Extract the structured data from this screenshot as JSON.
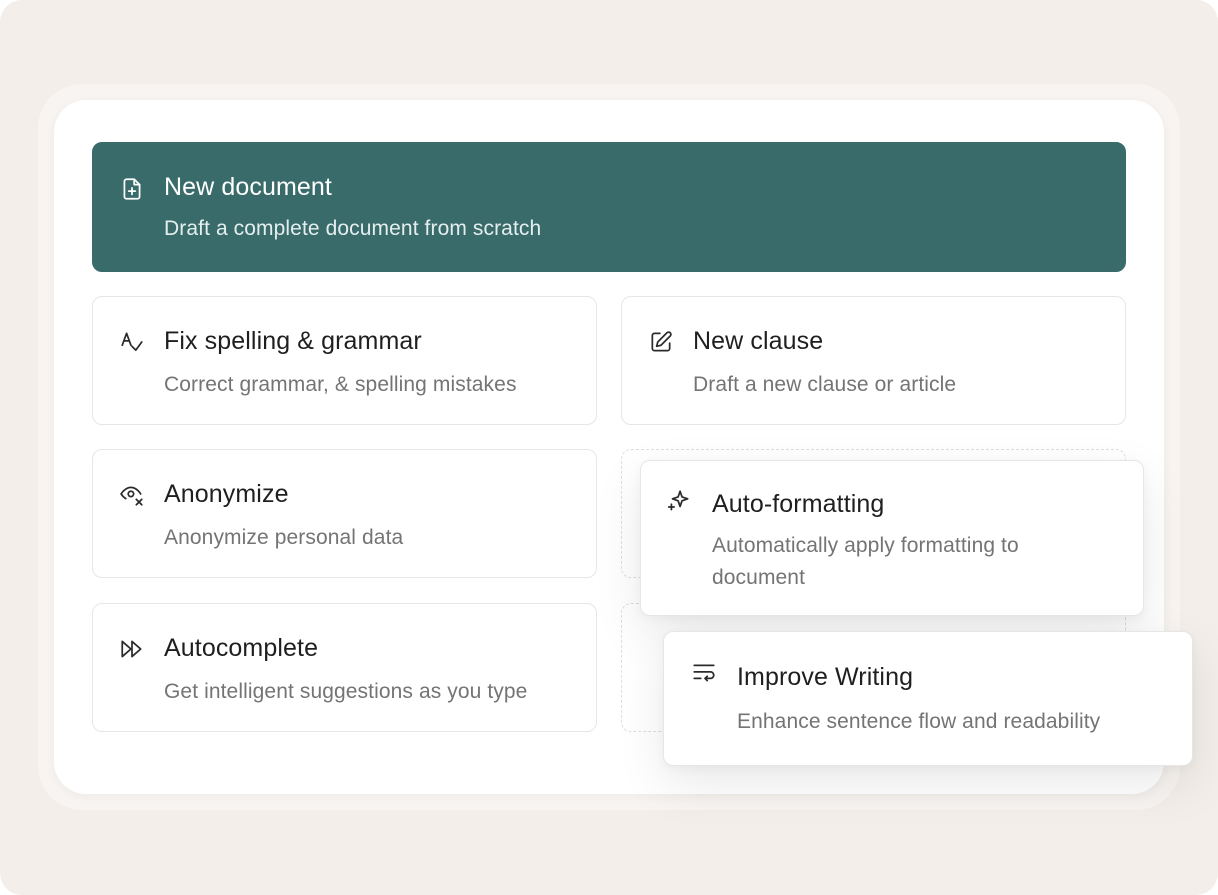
{
  "cards": {
    "new_document": {
      "title": "New document",
      "description": "Draft a complete document from scratch",
      "icon": "file-plus-icon"
    },
    "fix_spelling": {
      "title": "Fix spelling & grammar",
      "description": "Correct grammar, & spelling mistakes",
      "icon": "spell-check-icon"
    },
    "new_clause": {
      "title": "New clause",
      "description": "Draft a new clause or article",
      "icon": "edit-pencil-icon"
    },
    "anonymize": {
      "title": "Anonymize",
      "description": "Anonymize personal data",
      "icon": "eye-off-icon"
    },
    "auto_formatting": {
      "title": "Auto-formatting",
      "description": "Automatically apply formatting to document",
      "icon": "sparkles-icon"
    },
    "autocomplete": {
      "title": "Autocomplete",
      "description": "Get intelligent suggestions as you type",
      "icon": "fast-forward-icon"
    },
    "improve_writing": {
      "title": "Improve Writing",
      "description": "Enhance sentence flow and readability",
      "icon": "text-wrap-icon"
    }
  },
  "colors": {
    "background": "#f3eee9",
    "primary_card": "#3a6b6b",
    "title_text": "#1f1f1f",
    "description_text": "#747474",
    "card_border": "#e6e6e6"
  }
}
